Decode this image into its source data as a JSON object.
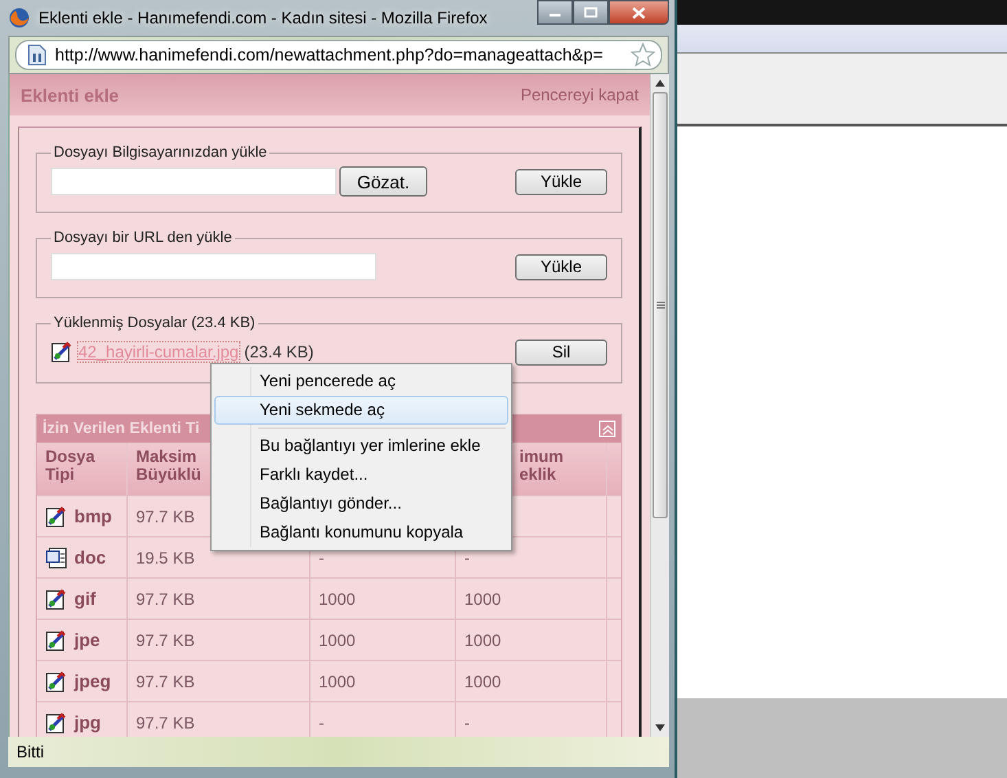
{
  "window": {
    "title": "Eklenti ekle - Hanımefendi.com - Kadın sitesi - Mozilla Firefox"
  },
  "address_bar": {
    "url": "http://www.hanimefendi.com/newattachment.php?do=manageattach&p="
  },
  "page": {
    "title": "Eklenti ekle",
    "close_link": "Pencereyi kapat"
  },
  "sections": [
    {
      "kind": "file",
      "legend": "Dosyayı Bilgisayarınızdan yükle",
      "browse_button": "Gözat.",
      "upload_button": "Yükle"
    },
    {
      "kind": "url",
      "legend": "Dosyayı bir URL den yükle",
      "upload_button": "Yükle"
    },
    {
      "kind": "uploaded",
      "legend": "Yüklenmiş Dosyalar (23.4 KB)",
      "file_name": "42_hayirli-cumalar.jpg",
      "file_size": "(23.4 KB)",
      "delete_button": "Sil"
    }
  ],
  "allowed_table": {
    "title": "İzin Verilen Eklenti Ti",
    "columns": [
      "Dosya Tipi",
      "Maksim Büyüklü",
      null,
      "imum eklik"
    ],
    "rows": [
      {
        "kind": "image",
        "cells": [
          "bmp",
          "97.7 KB"
        ]
      },
      {
        "kind": "word",
        "cells": [
          "doc",
          "19.5 KB",
          "-",
          "-"
        ]
      },
      {
        "kind": "image",
        "cells": [
          "gif",
          "97.7 KB",
          "1000",
          "1000"
        ]
      },
      {
        "kind": "image",
        "cells": [
          "jpe",
          "97.7 KB",
          "1000",
          "1000"
        ]
      },
      {
        "kind": "image",
        "cells": [
          "jpeg",
          "97.7 KB",
          "1000",
          "1000"
        ]
      },
      {
        "kind": "image",
        "cells": [
          "jpg",
          "97.7 KB",
          "-",
          "-"
        ]
      }
    ]
  },
  "context_menu": {
    "groups": [
      [
        {
          "label": "Yeni pencerede aç",
          "selected": false
        },
        {
          "label": "Yeni sekmede aç",
          "selected": true
        }
      ],
      [
        {
          "label": "Bu bağlantıyı yer imlerine ekle",
          "selected": false
        },
        {
          "label": "Farklı kaydet...",
          "selected": false
        },
        {
          "label": "Bağlantıyı gönder...",
          "selected": false
        },
        {
          "label": "Bağlantı konumunu kopyala",
          "selected": false
        }
      ]
    ]
  },
  "status_bar": {
    "text": "Bitti"
  }
}
